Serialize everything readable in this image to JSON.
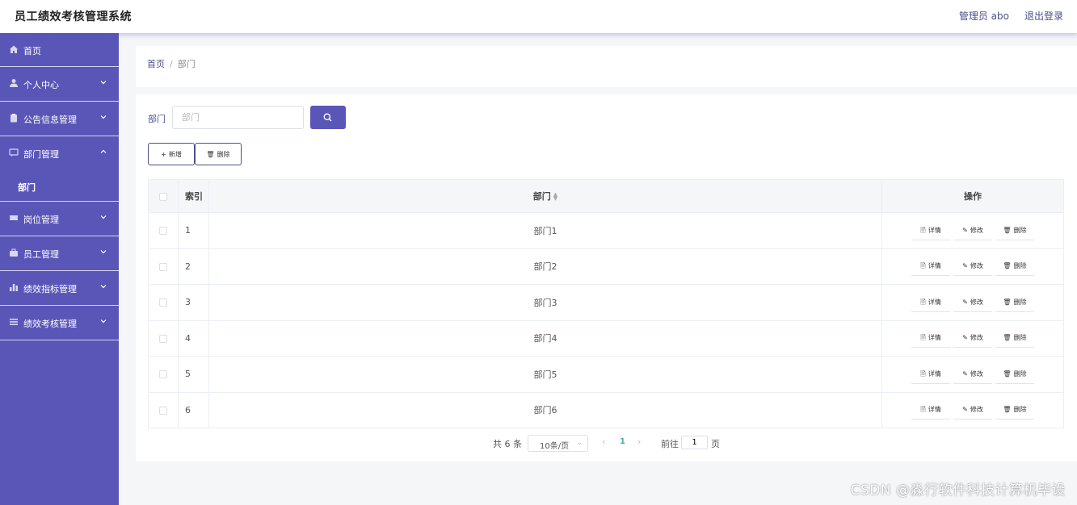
{
  "header": {
    "title": "员工绩效考核管理系统",
    "admin_label": "管理员 abo",
    "logout_label": "退出登录"
  },
  "sidebar": {
    "items": [
      {
        "label": "首页",
        "icon": "home-icon"
      },
      {
        "label": "个人中心",
        "icon": "user-icon"
      },
      {
        "label": "公告信息管理",
        "icon": "clipboard-icon"
      },
      {
        "label": "部门管理",
        "icon": "chat-icon"
      },
      {
        "label": "岗位管理",
        "icon": "ticket-icon"
      },
      {
        "label": "员工管理",
        "icon": "briefcase-icon"
      },
      {
        "label": "绩效指标管理",
        "icon": "bar-chart-icon"
      },
      {
        "label": "绩效考核管理",
        "icon": "list-icon"
      }
    ],
    "open_submenu": {
      "label": "部门"
    }
  },
  "breadcrumb": {
    "home": "首页",
    "separator": "/",
    "current": "部门"
  },
  "search": {
    "label": "部门",
    "placeholder": "部门",
    "value": ""
  },
  "toolbar": {
    "add_label": "新增",
    "delete_label": "删除"
  },
  "table": {
    "headers": {
      "index": "索引",
      "department": "部门",
      "actions": "操作"
    },
    "rows": [
      {
        "index": "1",
        "department": "部门1"
      },
      {
        "index": "2",
        "department": "部门2"
      },
      {
        "index": "3",
        "department": "部门3"
      },
      {
        "index": "4",
        "department": "部门4"
      },
      {
        "index": "5",
        "department": "部门5"
      },
      {
        "index": "6",
        "department": "部门6"
      }
    ],
    "row_actions": {
      "detail": "详情",
      "edit": "修改",
      "delete": "删除"
    }
  },
  "pagination": {
    "total": "共 6 条",
    "page_size": "10条/页",
    "current_page": "1",
    "goto_label": "前往",
    "goto_value": "1",
    "page_word": "页"
  },
  "watermark": "CSDN @淼行软件科技计算机毕设",
  "colors": {
    "sidebar_bg": "#5a56b8",
    "accent": "#5a56b8",
    "link": "#4a4f8c"
  }
}
